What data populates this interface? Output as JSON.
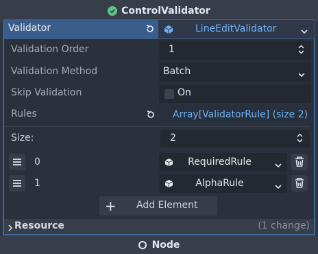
{
  "header": {
    "title": "ControlValidator",
    "icon": "check-circle-icon",
    "accent": "#5fc38a"
  },
  "validator": {
    "label": "Validator",
    "value": "LineEditValidator",
    "value_color": "#6fb1f7",
    "row_color": "#3a5d8c"
  },
  "properties": {
    "validation_order": {
      "label": "Validation Order",
      "value": "1"
    },
    "validation_method": {
      "label": "Validation Method",
      "value": "Batch"
    },
    "skip_validation": {
      "label": "Skip Validation",
      "value": "On",
      "checked": false
    },
    "rules": {
      "label": "Rules",
      "value": "Array[ValidatorRule] (size 2)"
    }
  },
  "array": {
    "size_label": "Size:",
    "size_value": "2",
    "items": [
      {
        "index": "0",
        "value": "RequiredRule"
      },
      {
        "index": "1",
        "value": "AlphaRule"
      }
    ],
    "add_label": "Add Element"
  },
  "resource": {
    "label": "Resource",
    "changes": "(1 change)"
  },
  "footer": {
    "label": "Node"
  }
}
